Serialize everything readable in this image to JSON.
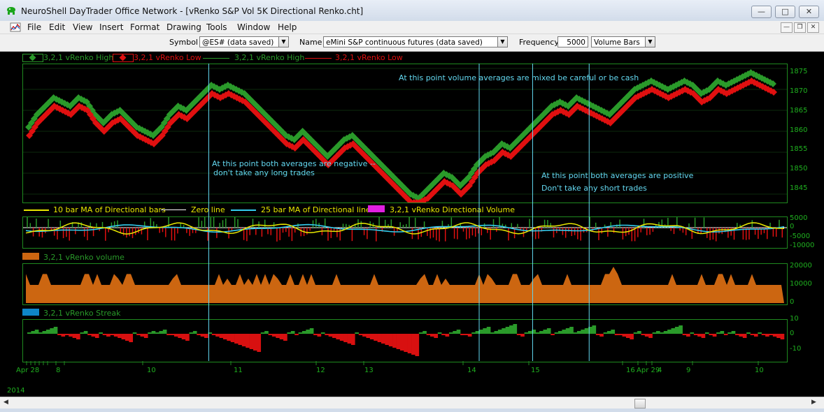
{
  "window": {
    "title": "NeuroShell DayTrader Office Network - [vRenko S&P Vol 5K Directional Renko.cht]"
  },
  "menu": [
    "File",
    "Edit",
    "View",
    "Insert",
    "Format",
    "Drawing",
    "Tools",
    "Window",
    "Help"
  ],
  "toolbar": {
    "symbol_label": "Symbol",
    "symbol_value": "@ES# (data saved)",
    "name_label": "Name",
    "name_value": "eMini S&P continuous futures (data saved)",
    "frequency_label": "Frequency",
    "frequency_value": "5000",
    "frequency_unit": "Volume Bars"
  },
  "colors": {
    "high": "#2a9a2a",
    "low": "#e01010",
    "yellow": "#e8e800",
    "cyan": "#33ccee",
    "magenta": "#e020e0",
    "orange": "#cc6611",
    "blue": "#0e86c8",
    "grid_green": "#1f8a1f",
    "marker": "#63d8f0"
  },
  "price_panel": {
    "legend": [
      "3,2,1 vRenko High",
      "3,2,1 vRenko Low",
      "3,2,1 vRenko High",
      "3,2,1 vRenko Low"
    ],
    "y_ticks": [
      "1875",
      "1870",
      "1865",
      "1860",
      "1855",
      "1850",
      "1845"
    ],
    "annotations": [
      "At this point volume averages are mixed be careful or be cash",
      "At this point both averages are negative --",
      "don't take any long trades",
      "At this point both averages are positive",
      "Don't take any short trades"
    ]
  },
  "directional_panel": {
    "legend": [
      "10 bar MA of Directional bars",
      "Zero line",
      "25 bar MA of Directional lines",
      "3,2,1 vRenko Directional Volume"
    ],
    "y_ticks": [
      "5000",
      "0",
      "-5000",
      "-10000"
    ]
  },
  "volume_panel": {
    "legend": [
      "3,2,1 vRenko volume"
    ],
    "y_ticks": [
      "20000",
      "10000",
      "0"
    ]
  },
  "streak_panel": {
    "legend": [
      "3,2,1 vRenko Streak"
    ],
    "y_ticks": [
      "10",
      "0",
      "-10"
    ]
  },
  "x_axis": {
    "labels": [
      "Apr 28",
      "8",
      "10",
      "11",
      "12",
      "13",
      "14",
      "15",
      "16",
      "Apr 29",
      "4",
      "9",
      "10"
    ],
    "year": "2014"
  },
  "chart_data": {
    "type": "line",
    "title": "",
    "xlabel": "",
    "ylabel": "",
    "ylim": [
      1843,
      1876
    ],
    "series": [
      {
        "name": "3,2,1 vRenko High",
        "values": [
          1861,
          1864,
          1866,
          1868,
          1867,
          1866,
          1868,
          1867,
          1864,
          1862,
          1864,
          1865,
          1863,
          1861,
          1860,
          1859,
          1861,
          1864,
          1866,
          1865,
          1867,
          1869,
          1871,
          1870,
          1871,
          1870,
          1869,
          1867,
          1865,
          1863,
          1861,
          1859,
          1858,
          1860,
          1858,
          1856,
          1854,
          1856,
          1858,
          1859,
          1857,
          1855,
          1853,
          1851,
          1849,
          1847,
          1845,
          1844,
          1846,
          1848,
          1850,
          1849,
          1847,
          1849,
          1852,
          1854,
          1855,
          1857,
          1856,
          1858,
          1860,
          1862,
          1864,
          1866,
          1867,
          1866,
          1868,
          1867,
          1866,
          1865,
          1864,
          1866,
          1868,
          1870,
          1871,
          1872,
          1871,
          1870,
          1871,
          1872,
          1871,
          1869,
          1870,
          1872,
          1871,
          1872,
          1873,
          1874,
          1873,
          1872,
          1871
        ]
      },
      {
        "name": "3,2,1 vRenko Low",
        "values": [
          1859,
          1862,
          1864,
          1866,
          1865,
          1864,
          1866,
          1865,
          1862,
          1860,
          1862,
          1863,
          1861,
          1859,
          1858,
          1857,
          1859,
          1862,
          1864,
          1863,
          1865,
          1867,
          1869,
          1868,
          1869,
          1868,
          1867,
          1865,
          1863,
          1861,
          1859,
          1857,
          1856,
          1858,
          1856,
          1854,
          1852,
          1854,
          1856,
          1857,
          1855,
          1853,
          1851,
          1849,
          1847,
          1845,
          1843,
          1843,
          1844,
          1846,
          1848,
          1847,
          1845,
          1847,
          1850,
          1852,
          1853,
          1855,
          1854,
          1856,
          1858,
          1860,
          1862,
          1864,
          1865,
          1864,
          1866,
          1865,
          1864,
          1863,
          1862,
          1864,
          1866,
          1868,
          1869,
          1870,
          1869,
          1868,
          1869,
          1870,
          1869,
          1867,
          1868,
          1870,
          1869,
          1870,
          1871,
          1872,
          1871,
          1870,
          1869
        ]
      }
    ],
    "markers_x_fraction": [
      0.244,
      0.598,
      0.668,
      0.742
    ]
  }
}
